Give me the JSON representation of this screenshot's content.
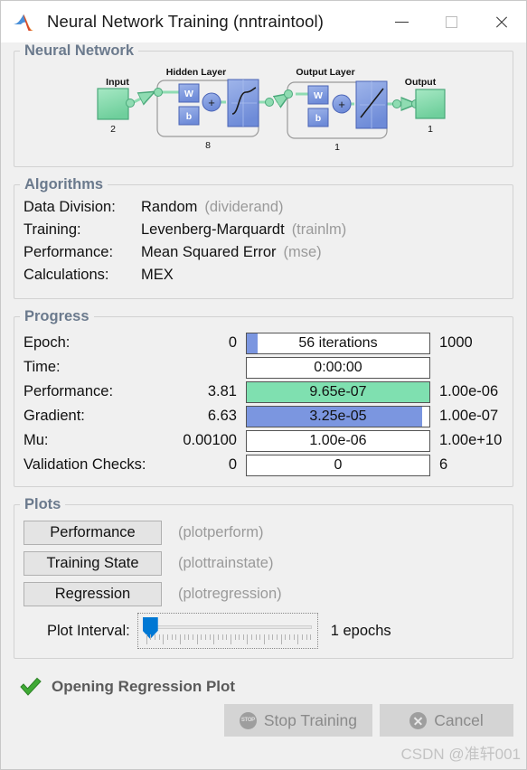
{
  "window": {
    "title": "Neural Network Training (nntraintool)",
    "app_icon": "matlab-membrane-icon",
    "minimize_label": "Minimize",
    "maximize_label": "Maximize",
    "close_label": "Close"
  },
  "neural_network": {
    "section_title": "Neural Network",
    "input_label": "Input",
    "input_size": "2",
    "hidden_layer_label": "Hidden Layer",
    "hidden_layer_size": "8",
    "output_layer_label": "Output Layer",
    "output_layer_size": "1",
    "output_label": "Output",
    "output_size": "1",
    "weight_symbol": "W",
    "bias_symbol": "b",
    "sum_symbol": "+",
    "hidden_transfer": "sigmoid",
    "output_transfer": "linear",
    "colors": {
      "block_green": "#7fd9a8",
      "block_blue": "#7b96e0",
      "line_green": "#8fdcb2"
    }
  },
  "algorithms": {
    "section_title": "Algorithms",
    "rows": [
      {
        "label": "Data Division:",
        "value": "Random",
        "fn": "(dividerand)"
      },
      {
        "label": "Training:",
        "value": "Levenberg-Marquardt",
        "fn": "(trainlm)"
      },
      {
        "label": "Performance:",
        "value": "Mean Squared Error",
        "fn": "(mse)"
      },
      {
        "label": "Calculations:",
        "value": "MEX",
        "fn": ""
      }
    ]
  },
  "progress": {
    "section_title": "Progress",
    "rows": [
      {
        "label": "Epoch:",
        "current": "0",
        "bar_text": "56 iterations",
        "max": "1000",
        "fill_pct": 5.8,
        "fill_color": "#7b96e0"
      },
      {
        "label": "Time:",
        "current": "",
        "bar_text": "0:00:00",
        "max": "",
        "fill_pct": 0,
        "fill_color": "#ffffff"
      },
      {
        "label": "Performance:",
        "current": "3.81",
        "bar_text": "9.65e-07",
        "max": "1.00e-06",
        "fill_pct": 100,
        "fill_color": "#7fe0b0"
      },
      {
        "label": "Gradient:",
        "current": "6.63",
        "bar_text": "3.25e-05",
        "max": "1.00e-07",
        "fill_pct": 96,
        "fill_color": "#7b96e0"
      },
      {
        "label": "Mu:",
        "current": "0.00100",
        "bar_text": "1.00e-06",
        "max": "1.00e+10",
        "fill_pct": 0,
        "fill_color": "#ffffff"
      },
      {
        "label": "Validation Checks:",
        "current": "0",
        "bar_text": "0",
        "max": "6",
        "fill_pct": 0,
        "fill_color": "#ffffff"
      }
    ]
  },
  "plots": {
    "section_title": "Plots",
    "buttons": [
      {
        "label": "Performance",
        "fn": "(plotperform)"
      },
      {
        "label": "Training State",
        "fn": "(plottrainstate)"
      },
      {
        "label": "Regression",
        "fn": "(plotregression)"
      }
    ],
    "interval_label": "Plot Interval:",
    "interval_value": "1 epochs",
    "interval_thumb_pct": 0
  },
  "status": {
    "icon": "green-check-icon",
    "text": "Opening Regression Plot"
  },
  "actions": {
    "stop_label": "Stop Training",
    "stop_icon": "stop-sign-icon",
    "stop_disabled": true,
    "cancel_label": "Cancel",
    "cancel_icon": "cancel-circle-icon",
    "cancel_disabled": true
  },
  "watermark": {
    "text": "CSDN @准轩001"
  }
}
